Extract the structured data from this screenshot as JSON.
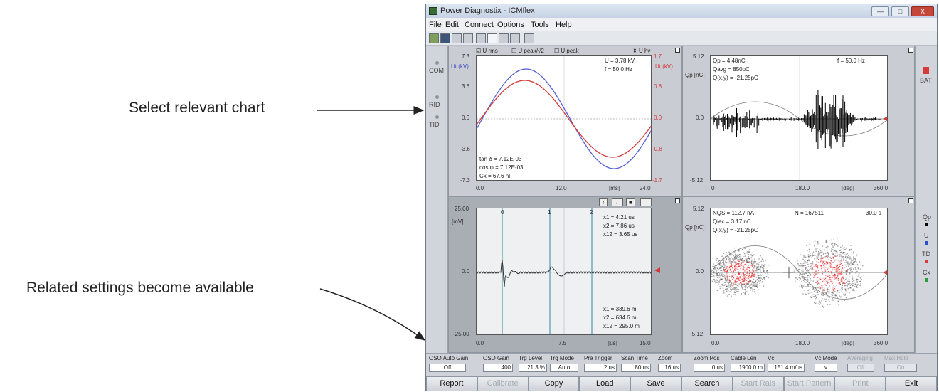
{
  "callouts": {
    "select_chart": "Select relevant chart",
    "related_settings": "Related settings become available"
  },
  "window": {
    "title": "Power Diagnostix - ICMflex",
    "controls": [
      "—",
      "□",
      "X"
    ]
  },
  "menu": [
    "File",
    "Edit",
    "Connect",
    "Options",
    "Tools",
    "Help"
  ],
  "sidebar_left": [
    "COM",
    "RID",
    "TID"
  ],
  "sidebar_right_top": "BAT",
  "sidebar_right_channels": [
    {
      "label": "Qp",
      "color": "#000000"
    },
    {
      "label": "U",
      "color": "#2a4fc6"
    },
    {
      "label": "TD",
      "color": "#d63a3a"
    },
    {
      "label": "Cx",
      "color": "#2f9a3a"
    }
  ],
  "chart1": {
    "checkboxes": [
      "U rms",
      "U peak/√2",
      "U peak"
    ],
    "uhv": "U hv",
    "ylabel_left": "Ut (kV)",
    "ylabel_right": "Ut (kV)",
    "ticks_left": [
      "7.3",
      "3.6",
      "0.0",
      "-3.6",
      "-7.3"
    ],
    "ticks_right": [
      "1.7",
      "0.8",
      "0.0",
      "-0.8",
      "-1.7"
    ],
    "ticks_x": [
      "0.0",
      "12.0",
      "[ms]",
      "24.0"
    ],
    "u_label": "U =",
    "u_value": "3.78 kV",
    "f_label": "f =",
    "f_value": "50.0 Hz",
    "tan_label": "tan δ =",
    "tan_value": "7.12E-03",
    "cos_label": "cos φ =",
    "cos_value": "7.12E-03",
    "cx_label": "Cx =",
    "cx_value": "67.6 nF"
  },
  "chart2": {
    "ylabel": "Qp [nC]",
    "ticks_y": [
      "5.12",
      "0.0",
      "-5.12"
    ],
    "ticks_x": [
      "0",
      "180.0",
      "[deg]",
      "360.0"
    ],
    "qp_label": "Qp =",
    "qp_value": "4.48nC",
    "qavg_label": "Qavg =",
    "qavg_value": "850pC",
    "qxy_label": "Q(x,y) =",
    "qxy_value": "-21.25pC",
    "f_label": "f =",
    "f_value": "50.0 Hz"
  },
  "chart3": {
    "ylabel": "[mV]",
    "ticks_y": [
      "25.00",
      "0.0",
      "-25.00"
    ],
    "ticks_x": [
      "0.0",
      "7.5",
      "[us]",
      "15.0"
    ],
    "cursor_labels": [
      "0",
      "1",
      "2"
    ],
    "top_meas": [
      {
        "label": "x1 =",
        "value": "4.21 us"
      },
      {
        "label": "x2 =",
        "value": "7.86 us"
      },
      {
        "label": "x12 =",
        "value": "3.65 us"
      }
    ],
    "bottom_meas": [
      {
        "label": "x1 =",
        "value": "339.6 m"
      },
      {
        "label": "x2 =",
        "value": "634.6 m"
      },
      {
        "label": "x12 =",
        "value": "295.0 m"
      }
    ],
    "toolbar": [
      "↑",
      "←",
      "■",
      "→"
    ]
  },
  "chart4": {
    "ylabel": "Qp [nC]",
    "ticks_y": [
      "5.12",
      "0.0",
      "-5.12"
    ],
    "ticks_x": [
      "0.0",
      "180.0",
      "[deg]",
      "360.0"
    ],
    "nqs_label": "NQS =",
    "nqs_value": "112.7 nA",
    "qiec_label": "Qiec =",
    "qiec_value": "3.17 nC",
    "qxy_label": "Q(x,y) =",
    "qxy_value": "-21.25pC",
    "n_label": "N =",
    "n_value": "167511",
    "time_value": "30.0 s"
  },
  "settings": [
    {
      "label": "OSO Auto Gain",
      "value": "Off",
      "disabled": false
    },
    {
      "label": "OSO Gain",
      "value": "400",
      "disabled": false
    },
    {
      "label": "Trg Level",
      "value": "21.3 %",
      "disabled": false
    },
    {
      "label": "Trg Mode",
      "value": "Auto",
      "disabled": false
    },
    {
      "label": "Pre Trigger",
      "value": "2 us",
      "disabled": false
    },
    {
      "label": "Scan Time",
      "value": "80 us",
      "disabled": false
    },
    {
      "label": "Zoom",
      "value": "16 us",
      "disabled": false
    },
    {
      "label": "Zoom Pos",
      "value": "0 us",
      "disabled": false
    },
    {
      "label": "Cable Len",
      "value": "1900.0 m",
      "disabled": false
    },
    {
      "label": "Vc",
      "value": "151.4 m/us",
      "disabled": false
    },
    {
      "label": "Vc Mode",
      "value": "v",
      "disabled": false
    },
    {
      "label": "Averaging",
      "value": "Off",
      "disabled": true
    },
    {
      "label": "Max Hold",
      "value": "On",
      "disabled": true
    }
  ],
  "buttons": [
    {
      "label": "Report",
      "disabled": false
    },
    {
      "label": "Calibrate",
      "disabled": true
    },
    {
      "label": "Copy",
      "disabled": false
    },
    {
      "label": "Load",
      "disabled": false
    },
    {
      "label": "Save",
      "disabled": false
    },
    {
      "label": "Search",
      "disabled": false
    },
    {
      "label": "Start Rais",
      "disabled": true
    },
    {
      "label": "Start Pattern",
      "disabled": true
    },
    {
      "label": "Print",
      "disabled": true
    },
    {
      "label": "Exit",
      "disabled": false
    }
  ],
  "colors": {
    "blue_trace": "#5360d6",
    "red_trace": "#d63a3a",
    "teal_cursor": "#2f8aa0"
  }
}
